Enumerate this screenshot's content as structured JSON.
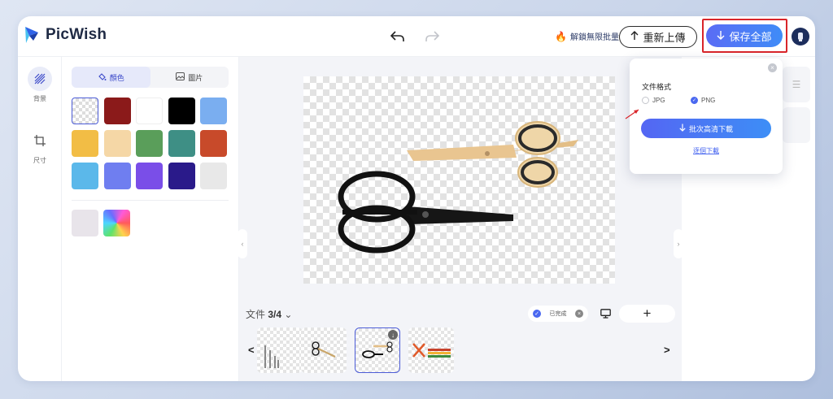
{
  "header": {
    "brand": "PicWish",
    "unlock_label": "解鎖無限批量",
    "reupload_label": "重新上傳",
    "save_all_label": "保存全部"
  },
  "rail": {
    "background_label": "背景",
    "size_label": "尺寸"
  },
  "panel": {
    "tab_color": "顏色",
    "tab_image": "圖片",
    "swatches": [
      "transparent",
      "#8b1a1a",
      "#ffffff",
      "#000000",
      "#7aaef0",
      "#f2bd45",
      "#f5d7a6",
      "#5a9e5a",
      "#3e8f85",
      "#c84a2a",
      "#5bb8ea",
      "#6f7ef0",
      "#7a4ee8",
      "#2a1a8a",
      "#e8e8e8"
    ],
    "custom_swatches": [
      "#e8e4ea",
      "rainbow"
    ]
  },
  "workspace": {
    "file_label": "文件",
    "file_counter": "3/4",
    "done_label": "已完成",
    "thumbnails": [
      "thumb-1",
      "thumb-2",
      "thumb-3",
      "thumb-4"
    ],
    "active_thumbnail": 3
  },
  "popup": {
    "title": "文件格式",
    "format_jpg": "JPG",
    "format_png": "PNG",
    "selected_format": "PNG",
    "batch_download_label": "批次高清下載",
    "single_download_label": "逐個下載"
  },
  "colors": {
    "accent": "#4a68f0",
    "highlight_box": "#d9252a"
  }
}
